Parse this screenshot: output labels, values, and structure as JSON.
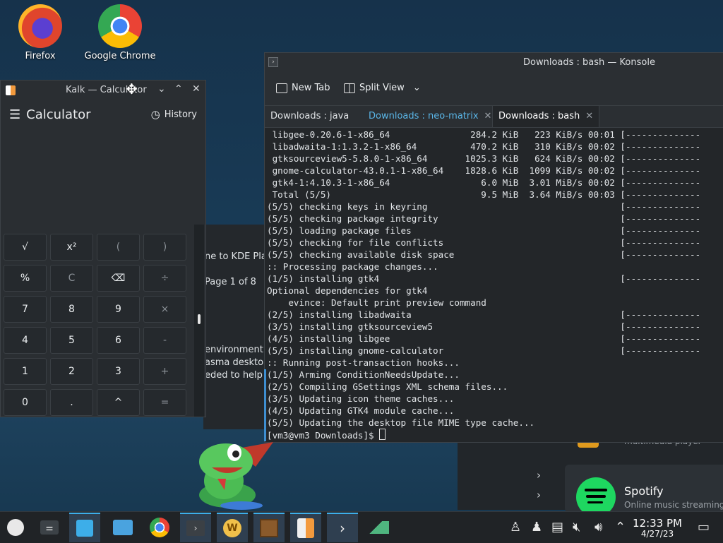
{
  "desktop": {
    "icons": [
      {
        "label": "Firefox"
      },
      {
        "label": "Google Chrome"
      }
    ]
  },
  "background_window": {
    "line1": "ne to KDE Pla",
    "page": "Page 1 of 8",
    "line2": "environment",
    "line3": "asma desktop",
    "line4": "eded to help"
  },
  "side_panel": {
    "item_desc": "multimedia player",
    "spotify_title": "Spotify",
    "spotify_desc": "Online music streaming"
  },
  "kalk": {
    "window_title": "Kalk — Calculator",
    "app_title": "Calculator",
    "history_label": "History",
    "keys": [
      "√",
      "x²",
      "(",
      ")",
      "%",
      "C",
      "⌫",
      "÷",
      "7",
      "8",
      "9",
      "×",
      "4",
      "5",
      "6",
      "-",
      "1",
      "2",
      "3",
      "+",
      "0",
      ".",
      "^",
      "="
    ]
  },
  "konsole": {
    "window_title": "Downloads : bash — Konsole",
    "toolbar": {
      "new_tab": "New Tab",
      "split_view": "Split View"
    },
    "tabs": [
      {
        "label": "Downloads : java"
      },
      {
        "label": "Downloads : neo-matrix"
      },
      {
        "label": "Downloads : bash"
      }
    ],
    "lines": [
      " libgee-0.20.6-1-x86_64               284.2 KiB   223 KiB/s 00:01 [--------------",
      " libadwaita-1:1.3.2-1-x86_64          470.2 KiB   310 KiB/s 00:02 [--------------",
      " gtksourceview5-5.8.0-1-x86_64       1025.3 KiB   624 KiB/s 00:02 [--------------",
      " gnome-calculator-43.0.1-1-x86_64    1828.6 KiB  1099 KiB/s 00:02 [--------------",
      " gtk4-1:4.10.3-1-x86_64                 6.0 MiB  3.01 MiB/s 00:02 [--------------",
      " Total (5/5)                            9.5 MiB  3.64 MiB/s 00:03 [--------------",
      "(5/5) checking keys in keyring                                    [--------------",
      "(5/5) checking package integrity                                  [--------------",
      "(5/5) loading package files                                       [--------------",
      "(5/5) checking for file conflicts                                 [--------------",
      "(5/5) checking available disk space                               [--------------",
      ":: Processing package changes...",
      "(1/5) installing gtk4                                             [--------------",
      "Optional dependencies for gtk4",
      "    evince: Default print preview command",
      "(2/5) installing libadwaita                                       [--------------",
      "(3/5) installing gtksourceview5                                   [--------------",
      "(4/5) installing libgee                                           [--------------",
      "(5/5) installing gnome-calculator                                 [--------------",
      ":: Running post-transaction hooks...",
      "(1/5) Arming ConditionNeedsUpdate...",
      "(2/5) Compiling GSettings XML schema files...",
      "(3/5) Updating icon theme caches...",
      "(4/5) Updating GTK4 module cache...",
      "(5/5) Updating the desktop file MIME type cache..."
    ],
    "prompt": "[vm3@vm3 Downloads]$ "
  },
  "taskbar": {
    "clock_time": "12:33 PM",
    "clock_date": "4/27/23"
  }
}
